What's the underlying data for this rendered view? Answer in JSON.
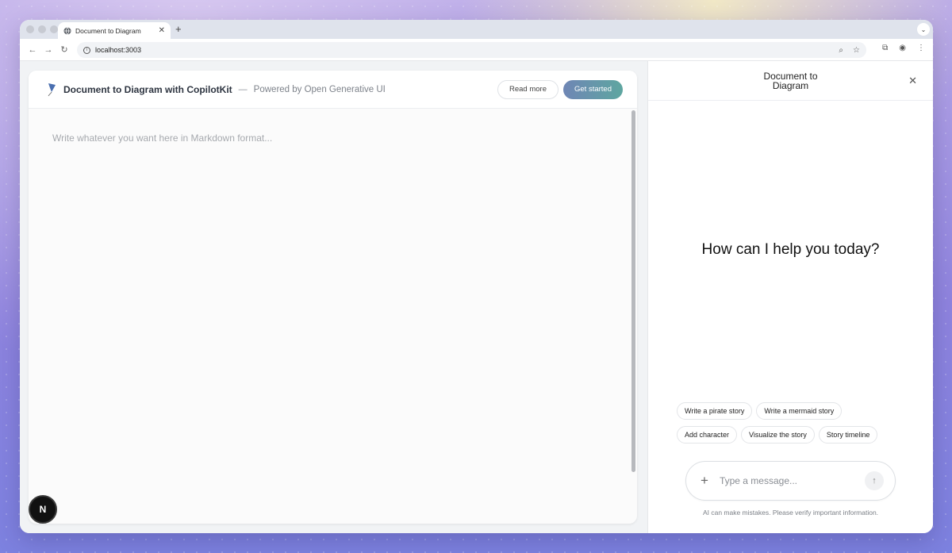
{
  "browser": {
    "tab_title": "Document to Diagram",
    "url": "localhost:3003"
  },
  "header": {
    "app_title": "Document to Diagram with CopilotKit",
    "separator": "—",
    "powered_by": "Powered by Open Generative UI",
    "read_more_label": "Read more",
    "get_started_label": "Get started"
  },
  "editor": {
    "placeholder": "Write whatever you want here in Markdown format..."
  },
  "badge": {
    "letter": "N"
  },
  "chat": {
    "title": "Document to Diagram",
    "greeting": "How can I help you today?",
    "suggestions": [
      {
        "label": "Write a pirate story"
      },
      {
        "label": "Write a mermaid story"
      },
      {
        "label": "Add character"
      },
      {
        "label": "Visualize the story"
      },
      {
        "label": "Story timeline"
      }
    ],
    "input_placeholder": "Type a message...",
    "disclaimer": "AI can make mistakes. Please verify important information."
  },
  "colors": {
    "accent_start": "#6f86b5",
    "accent_end": "#5ea6a0"
  }
}
